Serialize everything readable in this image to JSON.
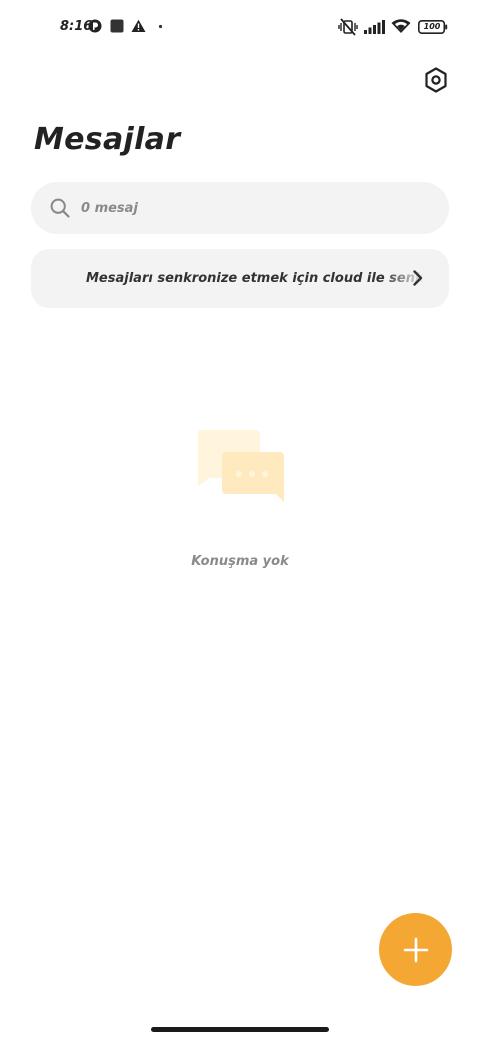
{
  "status_bar": {
    "time": "8:16",
    "battery": "100",
    "icons": [
      "notification-app-icon",
      "square-app-icon",
      "warning-icon",
      "dot-icon",
      "vibrate-off-icon",
      "signal-icon",
      "wifi-icon",
      "battery-icon"
    ]
  },
  "header": {
    "title": "Mesajlar",
    "settings_icon": "settings-hexagon-icon"
  },
  "search": {
    "placeholder": "0 mesaj",
    "value": "",
    "icon": "search-icon"
  },
  "sync_banner": {
    "text": "Mesajları senkronize etmek için cloud ile senkronize et",
    "icon": "chevron-right-icon"
  },
  "empty_state": {
    "text": "Konuşma yok",
    "icon": "chat-bubbles-icon"
  },
  "fab": {
    "icon": "plus-icon"
  },
  "colors": {
    "accent": "#f5a734",
    "surface": "#f3f3f3",
    "text_primary": "#222222",
    "text_secondary": "#8a8a8a"
  }
}
